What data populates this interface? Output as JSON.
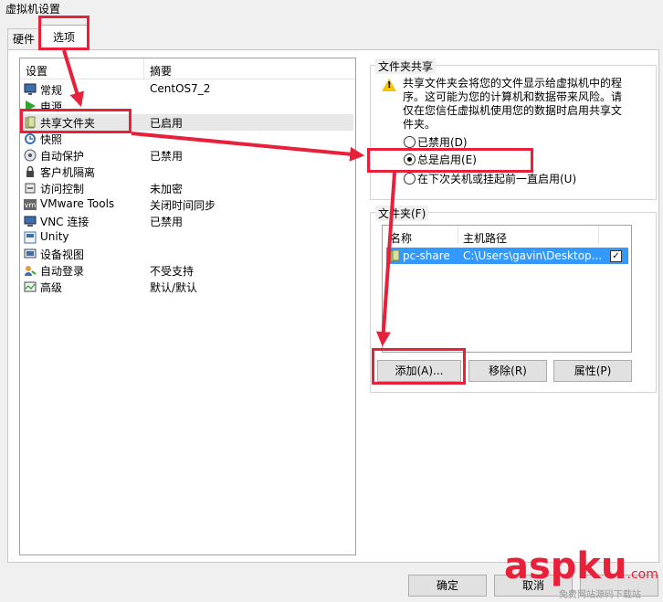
{
  "window": {
    "title": "虚拟机设置"
  },
  "tabs": [
    {
      "label": "硬件"
    },
    {
      "label": "选项"
    }
  ],
  "settings_list": {
    "headers": {
      "setting": "设置",
      "summary": "摘要"
    },
    "rows": [
      {
        "name": "常规",
        "summary": "CentOS7_2",
        "icon": "monitor-icon"
      },
      {
        "name": "电源",
        "summary": "",
        "icon": "power-play-icon"
      },
      {
        "name": "共享文件夹",
        "summary": "已启用",
        "icon": "shared-folder-icon"
      },
      {
        "name": "快照",
        "summary": "",
        "icon": "snapshot-icon"
      },
      {
        "name": "自动保护",
        "summary": "已禁用",
        "icon": "autoprotect-icon"
      },
      {
        "name": "客户机隔离",
        "summary": "",
        "icon": "isolation-icon"
      },
      {
        "name": "访问控制",
        "summary": "未加密",
        "icon": "access-control-icon"
      },
      {
        "name": "VMware Tools",
        "summary": "关闭时间同步",
        "icon": "vm-icon"
      },
      {
        "name": "VNC 连接",
        "summary": "已禁用",
        "icon": "vnc-icon"
      },
      {
        "name": "Unity",
        "summary": "",
        "icon": "unity-icon"
      },
      {
        "name": "设备视图",
        "summary": "",
        "icon": "device-view-icon"
      },
      {
        "name": "自动登录",
        "summary": "不受支持",
        "icon": "autologin-icon"
      },
      {
        "name": "高级",
        "summary": "默认/默认",
        "icon": "advanced-icon"
      }
    ],
    "selected": "共享文件夹"
  },
  "sharing": {
    "group_title": "文件夹共享",
    "description": "共享文件夹会将您的文件显示给虚拟机中的程序。这可能为您的计算机和数据带来风险。请仅在您信任虚拟机使用您的数据时启用共享文件夹。",
    "options": [
      {
        "label": "已禁用(D)"
      },
      {
        "label": "总是启用(E)"
      },
      {
        "label": "在下次关机或挂起前一直启用(U)"
      }
    ],
    "selected_option": "总是启用(E)"
  },
  "folders": {
    "group_title": "文件夹(F)",
    "headers": {
      "name": "名称",
      "host_path": "主机路径"
    },
    "rows": [
      {
        "name": "pc-share",
        "host_path": "C:\\Users\\gavin\\Desktop...",
        "enabled": true
      }
    ],
    "buttons": {
      "add": "添加(A)...",
      "remove": "移除(R)",
      "properties": "属性(P)"
    }
  },
  "dialog_buttons": {
    "ok": "确定",
    "cancel": "取消"
  },
  "watermark": {
    "brand": "aspku",
    "tld": ".com",
    "tagline": "免费网站源码下载站"
  },
  "colors": {
    "annotation": "#e8203a",
    "selection": "#3399ff"
  }
}
